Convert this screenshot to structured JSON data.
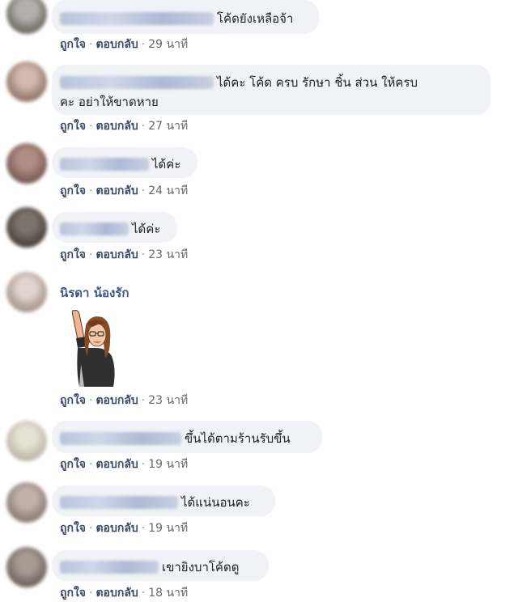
{
  "actions": {
    "like": "ถูกใจ",
    "reply": "ตอบกลับ",
    "separator": "·"
  },
  "comments": [
    {
      "text": "โค้ดยังเหลือจ้า",
      "time": "29 นาที",
      "avatar_color": "#8d8b86"
    },
    {
      "text_line1": "ได้คะ โค้ด ครบ รักษา ชิ้น ส่วน ให้ครบ",
      "text_line2": "คะ อย่าให้ขาดหาย",
      "time": "27 นาที",
      "avatar_color": "#a88f86"
    },
    {
      "text": "ได้ค่ะ",
      "time": "24 นาที",
      "avatar_color": "#8b6d66"
    },
    {
      "text": "ได้ค่ะ",
      "time": "23 นาที",
      "avatar_color": "#5e5650"
    },
    {
      "name": "นิรดา น้องรัก",
      "time": "23 นาที",
      "avatar_color": "#b9aba3"
    },
    {
      "text": "ขึ้นได้ตามร้านรับขึ้น",
      "time": "19 นาที",
      "avatar_color": "#c9c7b9"
    },
    {
      "text": "ได้แน่นอนคะ",
      "time": "19 นาที",
      "avatar_color": "#9c8e88"
    },
    {
      "text": "เขายิงบาโค้ดดู",
      "time": "18 นาที",
      "avatar_color": "#7e7570"
    }
  ]
}
